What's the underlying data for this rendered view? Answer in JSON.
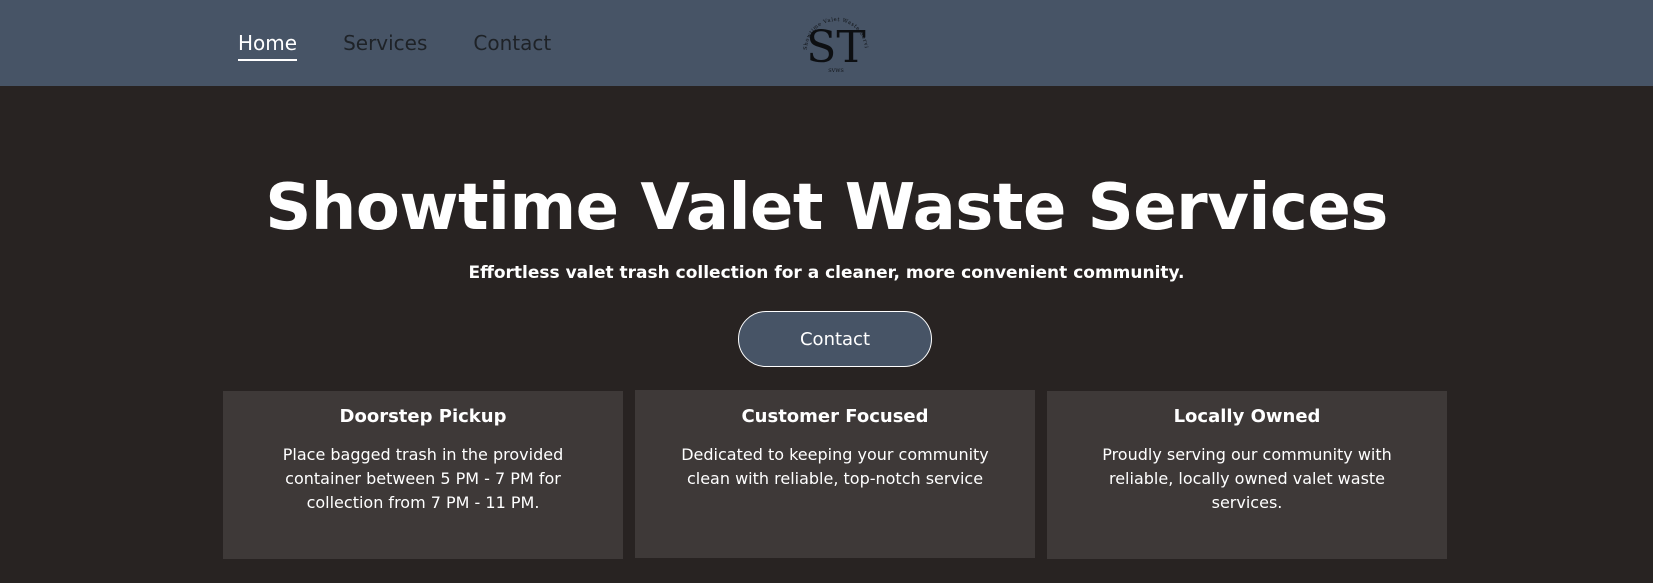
{
  "nav": {
    "items": [
      {
        "label": "Home",
        "active": true
      },
      {
        "label": "Services",
        "active": false
      },
      {
        "label": "Contact",
        "active": false
      }
    ]
  },
  "logo": {
    "monogram": "ST",
    "ring_text": "Showtime Valet Waste Services",
    "bottom_text": "SVWS"
  },
  "hero": {
    "title": "Showtime Valet Waste Services",
    "subtitle": "Effortless valet trash collection for a cleaner, more convenient community.",
    "cta_label": "Contact"
  },
  "features": [
    {
      "title": "Doorstep Pickup",
      "text": "Place bagged trash in the provided container between 5 PM - 7 PM for collection from 7 PM - 11 PM."
    },
    {
      "title": "Customer Focused",
      "text": "Dedicated to keeping your community clean with reliable, top-notch service"
    },
    {
      "title": "Locally Owned",
      "text": "Proudly serving our community with reliable, locally owned valet waste services."
    }
  ],
  "colors": {
    "header_bg": "#475466",
    "page_bg": "#282322",
    "card_bg": "#3e3938",
    "text_light": "#ffffff",
    "nav_text": "#1e2227"
  }
}
